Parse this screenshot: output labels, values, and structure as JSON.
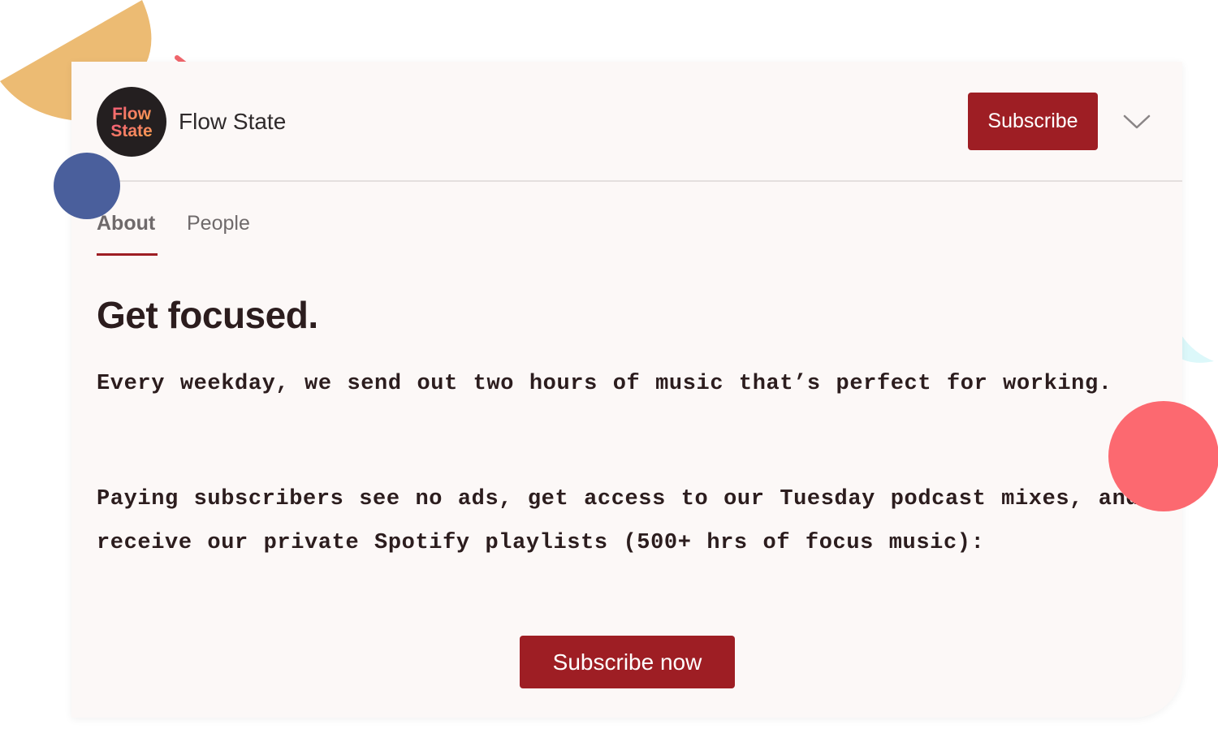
{
  "publication": {
    "name": "Flow State",
    "logo_text_line1": "Flow",
    "logo_text_line2": "State"
  },
  "header": {
    "subscribe_label": "Subscribe",
    "menu_icon": "chevron-down-icon"
  },
  "tabs": [
    {
      "label": "About",
      "active": true
    },
    {
      "label": "People",
      "active": false
    }
  ],
  "content": {
    "headline": "Get focused.",
    "paragraphs": [
      "Every weekday, we send out two hours of music that’s perfect for working.",
      "Paying subscribers see no ads, get access to our Tuesday podcast mixes, and receive our private Spotify playlists (500+ hrs of focus music):"
    ],
    "cta_label": "Subscribe now"
  },
  "colors": {
    "accent": "#9e1e24",
    "card_background": "#fcf8f7",
    "text": "#2c1d1e",
    "deco_orange": "#ecbb73",
    "deco_blue": "#4a5f9c",
    "deco_red": "#fc6970",
    "deco_pink_dash": "#f0666c",
    "deco_cyan": "#dcf8fa"
  }
}
